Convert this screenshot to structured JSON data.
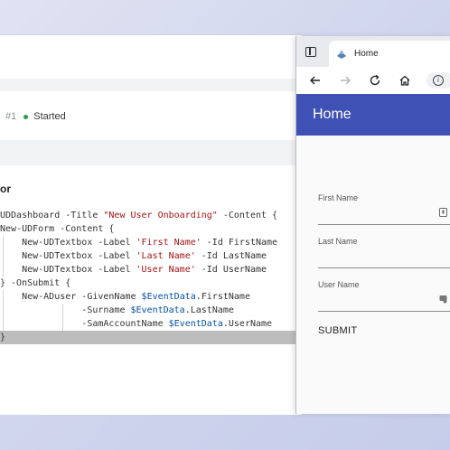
{
  "jobs": {
    "run_number": "#1",
    "status": "Started",
    "status_color": "#2e9d4a"
  },
  "editor": {
    "section_title": "or",
    "code": {
      "l1_a": "UDDashboard -Title ",
      "l1_b": "\"New User Onboarding\"",
      "l1_c": " -Content {",
      "l2": "New-UDForm -Content {",
      "l3_a": "    New-UDTextbox -Label ",
      "l3_b": "'First Name'",
      "l3_c": " -Id FirstName",
      "l4_a": "    New-UDTextbox -Label ",
      "l4_b": "'Last Name'",
      "l4_c": " -Id LastName",
      "l5_a": "    New-UDTextbox -Label ",
      "l5_b": "'User Name'",
      "l5_c": " -Id UserName",
      "l6": "} -OnSubmit {",
      "l7_a": "    New-ADuser -GivenName ",
      "l7_b": "$EventData",
      "l7_c": ".FirstName",
      "l8_a": "               -Surname ",
      "l8_b": "$EventData",
      "l8_c": ".LastName",
      "l9_a": "               -SamAccountName ",
      "l9_b": "$EventData",
      "l9_c": ".UserName",
      "l10": "}"
    }
  },
  "browser": {
    "tab_title": "Home",
    "toolbar": {
      "back_icon": "back-arrow-icon",
      "forward_icon": "forward-arrow-icon",
      "refresh_icon": "refresh-icon",
      "home_icon": "home-icon",
      "info_icon": "info-icon",
      "info_glyph": "i"
    },
    "app": {
      "title": "Home",
      "accent": "#3f51b5"
    },
    "form": {
      "first_name_label": "First Name",
      "first_name_value": "",
      "last_name_label": "Last Name",
      "last_name_value": "",
      "user_name_label": "User Name",
      "user_name_value": "",
      "submit_label": "SUBMIT"
    }
  }
}
